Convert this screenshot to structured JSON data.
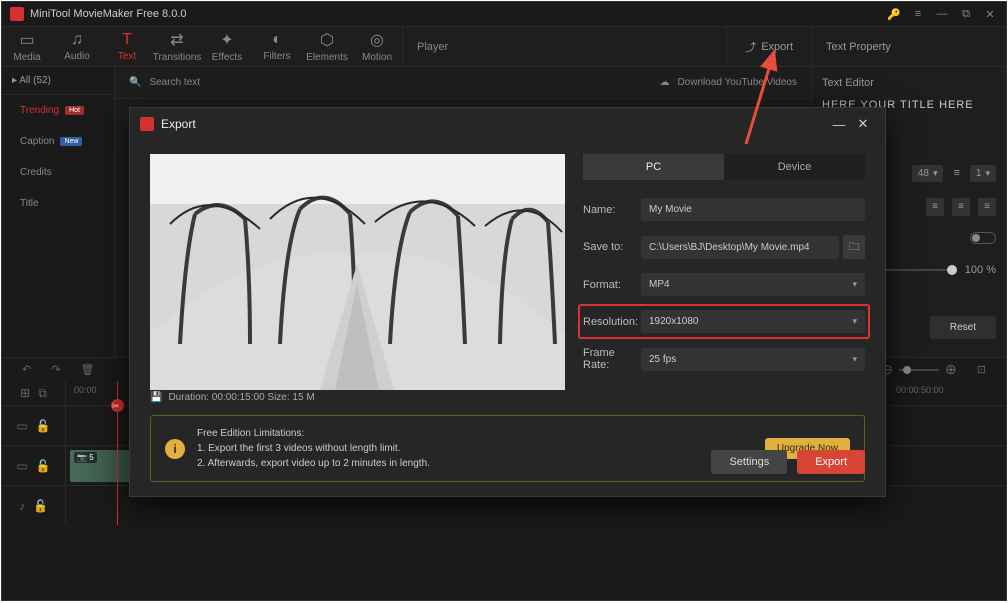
{
  "app": {
    "title": "MiniTool MovieMaker Free 8.0.0"
  },
  "toolbar": {
    "media": "Media",
    "audio": "Audio",
    "text": "Text",
    "transitions": "Transitions",
    "effects": "Effects",
    "filters": "Filters",
    "elements": "Elements",
    "motion": "Motion",
    "player": "Player",
    "export": "Export",
    "property": "Text Property"
  },
  "sidebar": {
    "all": "All (52)",
    "items": [
      {
        "label": "Trending",
        "badge": "Hot"
      },
      {
        "label": "Caption",
        "badge": "New"
      },
      {
        "label": "Credits",
        "badge": ""
      },
      {
        "label": "Title",
        "badge": ""
      }
    ]
  },
  "searchRow": {
    "search": "Search text",
    "download": "Download YouTube Videos"
  },
  "rightPanel": {
    "header": "Text Editor",
    "titlePreview": "HERE YOUR TITLE HERE",
    "fontSize": "48",
    "lineHeight": "1",
    "opacity": "100 %",
    "reset": "Reset"
  },
  "timeline": {
    "t0": "00:00",
    "t1": "00:00:50:00",
    "clipLabel": "5"
  },
  "dialog": {
    "title": "Export",
    "tabs": {
      "pc": "PC",
      "device": "Device"
    },
    "labels": {
      "name": "Name:",
      "saveto": "Save to:",
      "format": "Format:",
      "resolution": "Resolution:",
      "framerate": "Frame Rate:"
    },
    "values": {
      "name": "My Movie",
      "saveto": "C:\\Users\\BJ\\Desktop\\My Movie.mp4",
      "format": "MP4",
      "resolution": "1920x1080",
      "framerate": "25 fps"
    },
    "duration": "Duration:  00:00:15:00  Size:  15 M",
    "limits": {
      "title": "Free Edition Limitations:",
      "line1": "1. Export the first 3 videos without length limit.",
      "line2": "2. Afterwards, export video up to 2 minutes in length."
    },
    "buttons": {
      "upgrade": "Upgrade Now",
      "settings": "Settings",
      "export": "Export"
    }
  }
}
